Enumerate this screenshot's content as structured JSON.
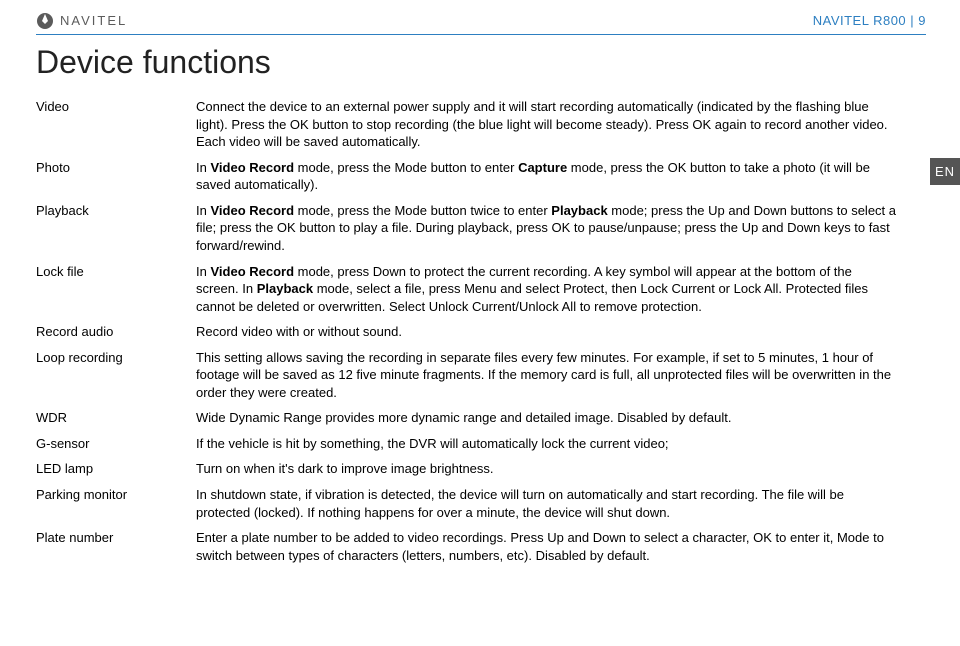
{
  "brand": "NAVITEL",
  "header_right": "NAVITEL R800 | 9",
  "title": "Device functions",
  "lang_tab": "EN",
  "rows": [
    {
      "label": "Video",
      "desc": "Connect the device to an external power supply and it will start recording automatically (indicated by the flashing blue light). Press the OK button to stop recording (the blue light will become steady). Press OK again to record another video. Each video will be saved automatically."
    },
    {
      "label": "Photo",
      "desc": "In <b>Video Record</b> mode, press the Mode button to enter <b>Capture</b> mode, press the OK button to take a photo (it will be saved automatically)."
    },
    {
      "label": "Playback",
      "desc": "In <b>Video Record</b> mode, press the Mode button twice to enter <b>Playback</b> mode; press the Up and Down buttons to select a file; press the OK button to play a file. During playback, press OK to pause/unpause; press the Up and Down keys to fast forward/rewind."
    },
    {
      "label": "Lock file",
      "desc": "In <b>Video Record</b> mode, press Down to protect the current recording. A key symbol will appear at the bottom of the screen. In <b>Playback</b> mode, select a file, press Menu and select Protect, then Lock Current or Lock All. Protected files cannot be deleted or overwritten. Select Unlock Current/Unlock All to remove protection."
    },
    {
      "label": "Record audio",
      "desc": "Record video with or without sound."
    },
    {
      "label": "Loop recording",
      "desc": "This setting allows saving the recording in separate files every few minutes. For example, if set to 5 minutes, 1 hour of footage will be saved as 12 five minute fragments. If the memory card is full, all unprotected files will be overwritten in the order they were created."
    },
    {
      "label": "WDR",
      "desc": "Wide Dynamic Range provides more dynamic range and detailed image. Disabled by default."
    },
    {
      "label": "G-sensor",
      "desc": "If the vehicle is hit by something, the DVR will automatically lock the current video;"
    },
    {
      "label": "LED lamp",
      "desc": "Turn on when it's dark to improve image brightness."
    },
    {
      "label": "Parking monitor",
      "desc": "In shutdown state, if vibration is detected, the device will turn on automatically and start recording. The file will be protected (locked). If nothing happens for over a minute, the device will shut down."
    },
    {
      "label": "Plate number",
      "desc": "Enter a plate number to be added to video recordings. Press Up and Down to select a character, OK to enter it, Mode to switch between types of characters (letters, numbers, etc). Disabled by default."
    }
  ]
}
